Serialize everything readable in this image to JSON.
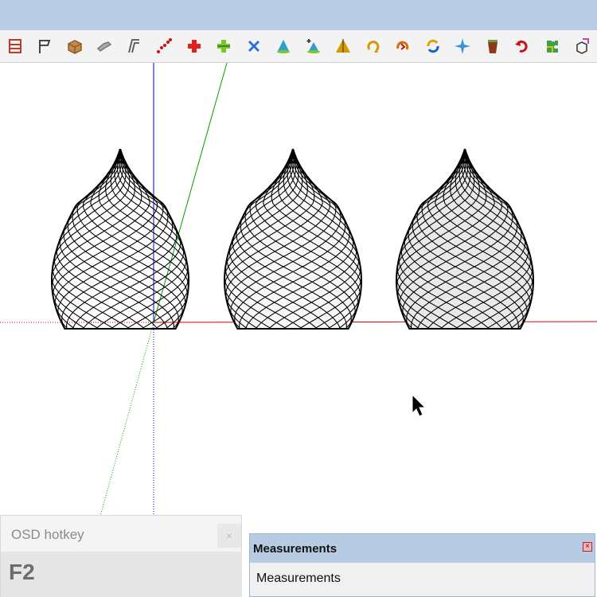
{
  "window": {
    "title": ""
  },
  "toolbar": {
    "tools": [
      {
        "icon": "list-box-icon",
        "color": "#c0392b"
      },
      {
        "icon": "flag-icon",
        "color": "#333333"
      },
      {
        "icon": "box-icon",
        "color": "#8b5a2b"
      },
      {
        "icon": "pipe-icon",
        "color": "#777777"
      },
      {
        "icon": "offset-icon",
        "color": "#555555"
      },
      {
        "icon": "dotted-curve-icon",
        "color": "#d01010"
      },
      {
        "icon": "red-cross-icon",
        "color": "#e02020"
      },
      {
        "icon": "green-cross-icon",
        "color": "#7ac62d"
      },
      {
        "icon": "blue-x-icon",
        "color": "#2a6fd6"
      },
      {
        "icon": "cone-icon",
        "color": "#2aa0d0"
      },
      {
        "icon": "cone-plus-icon",
        "color": "#2aa0d0"
      },
      {
        "icon": "triangle-icon",
        "color": "#d49a00"
      },
      {
        "icon": "rotate-arrow-icon",
        "color": "#d49a00"
      },
      {
        "icon": "fire-rotate-icon",
        "color": "#d07000"
      },
      {
        "icon": "circle-arrows-icon",
        "color": "#1a5fd0"
      },
      {
        "icon": "star-move-icon",
        "color": "#3a8fe0"
      },
      {
        "icon": "bucket-icon",
        "color": "#8b3a1a"
      },
      {
        "icon": "undo-arrow-icon",
        "color": "#cc1111"
      },
      {
        "icon": "puzzle-icon",
        "color": "#3aa04a"
      },
      {
        "icon": "cube-arrow-icon",
        "color": "#cc44aa"
      }
    ]
  },
  "colors": {
    "titlebar": "#b9cde5",
    "axis_red": "#d40000",
    "axis_green": "#00a000",
    "axis_blue": "#0000c8"
  },
  "osd": {
    "title": "OSD hotkey",
    "close_label": "×",
    "key": "F2"
  },
  "measurements": {
    "title": "Measurements",
    "close_label": "×",
    "label": "Measurements"
  }
}
